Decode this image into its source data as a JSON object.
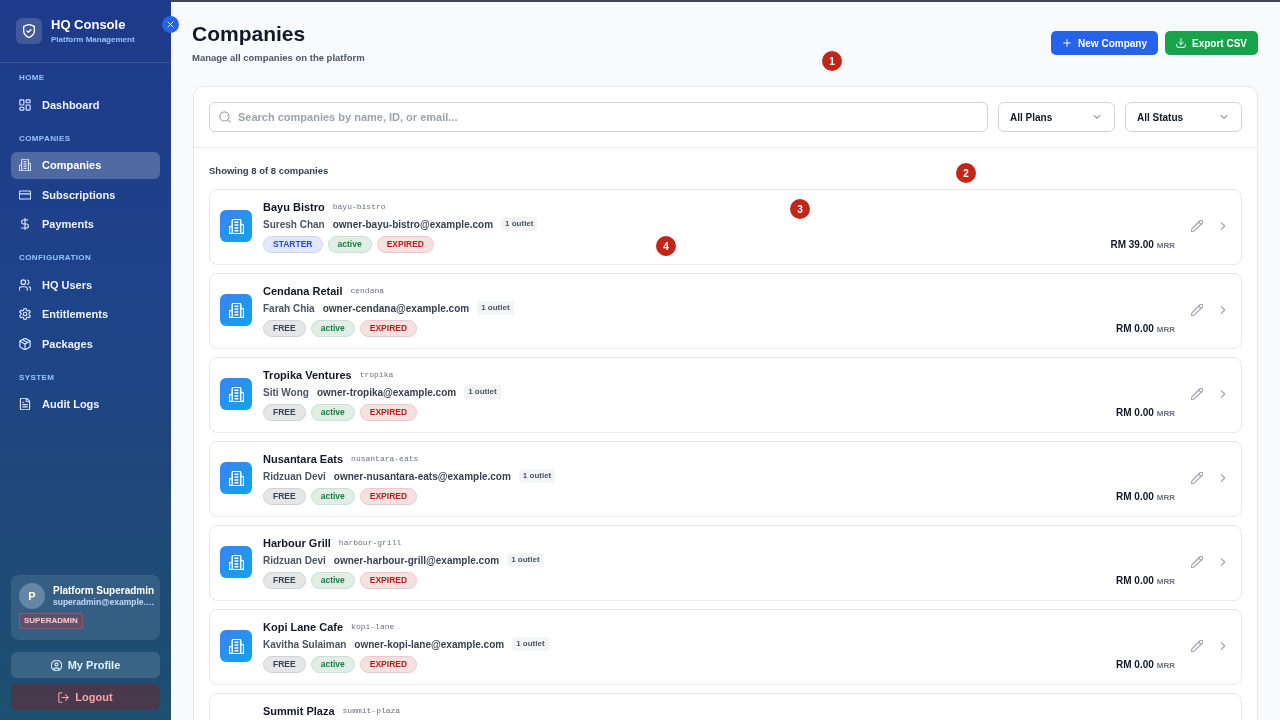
{
  "sidebar": {
    "title": "HQ Console",
    "subtitle": "Platform Management",
    "sections": [
      {
        "label": "HOME",
        "items": [
          {
            "label": "Dashboard",
            "selected": false
          }
        ]
      },
      {
        "label": "COMPANIES",
        "items": [
          {
            "label": "Companies",
            "selected": true
          },
          {
            "label": "Subscriptions",
            "selected": false
          },
          {
            "label": "Payments",
            "selected": false
          }
        ]
      },
      {
        "label": "CONFIGURATION",
        "items": [
          {
            "label": "HQ Users",
            "selected": false
          },
          {
            "label": "Entitlements",
            "selected": false
          },
          {
            "label": "Packages",
            "selected": false
          }
        ]
      },
      {
        "label": "SYSTEM",
        "items": [
          {
            "label": "Audit Logs",
            "selected": false
          }
        ]
      }
    ],
    "user": {
      "initial": "P",
      "name": "Platform Superadmin",
      "email": "superadmin@example.…",
      "role": "SUPERADMIN"
    },
    "actions": [
      {
        "label": "My Profile",
        "kind": "profile"
      },
      {
        "label": "Logout",
        "kind": "logout"
      }
    ]
  },
  "header": {
    "title": "Companies",
    "subtitle": "Manage all companies on the platform",
    "actions": [
      {
        "label": "New Company",
        "kind": "new"
      },
      {
        "label": "Export CSV",
        "kind": "export"
      }
    ]
  },
  "filters": {
    "search": {
      "placeholder": "Search companies by name, ID, or email..."
    },
    "selects": [
      {
        "value": "All Plans"
      },
      {
        "value": "All Status"
      }
    ]
  },
  "summary": "Showing 8 of 8 companies",
  "companies": [
    {
      "name": "Bayu Bistro",
      "slug": "bayu-bistro",
      "owner": "Suresh Chan",
      "email": "owner-bayu-bistro@example.com",
      "outlets": "1 outlet",
      "tags": [
        {
          "label": "STARTER",
          "color": "#1d4ed8"
        },
        {
          "label": "active",
          "color": "#15803d"
        },
        {
          "label": "EXPIRED",
          "color": "#b91c1c"
        }
      ],
      "mrr": "RM 39.00",
      "mrr_unit": "MRR"
    },
    {
      "name": "Cendana Retail",
      "slug": "cendana",
      "owner": "Farah Chia",
      "email": "owner-cendana@example.com",
      "outlets": "1 outlet",
      "tags": [
        {
          "label": "FREE",
          "color": "#374151"
        },
        {
          "label": "active",
          "color": "#15803d"
        },
        {
          "label": "EXPIRED",
          "color": "#b91c1c"
        }
      ],
      "mrr": "RM 0.00",
      "mrr_unit": "MRR"
    },
    {
      "name": "Tropika Ventures",
      "slug": "tropika",
      "owner": "Siti Wong",
      "email": "owner-tropika@example.com",
      "outlets": "1 outlet",
      "tags": [
        {
          "label": "FREE",
          "color": "#374151"
        },
        {
          "label": "active",
          "color": "#15803d"
        },
        {
          "label": "EXPIRED",
          "color": "#b91c1c"
        }
      ],
      "mrr": "RM 0.00",
      "mrr_unit": "MRR"
    },
    {
      "name": "Nusantara Eats",
      "slug": "nusantara-eats",
      "owner": "Ridzuan Devi",
      "email": "owner-nusantara-eats@example.com",
      "outlets": "1 outlet",
      "tags": [
        {
          "label": "FREE",
          "color": "#374151"
        },
        {
          "label": "active",
          "color": "#15803d"
        },
        {
          "label": "EXPIRED",
          "color": "#b91c1c"
        }
      ],
      "mrr": "RM 0.00",
      "mrr_unit": "MRR"
    },
    {
      "name": "Harbour Grill",
      "slug": "harbour-grill",
      "owner": "Ridzuan Devi",
      "email": "owner-harbour-grill@example.com",
      "outlets": "1 outlet",
      "tags": [
        {
          "label": "FREE",
          "color": "#374151"
        },
        {
          "label": "active",
          "color": "#15803d"
        },
        {
          "label": "EXPIRED",
          "color": "#b91c1c"
        }
      ],
      "mrr": "RM 0.00",
      "mrr_unit": "MRR"
    },
    {
      "name": "Kopi Lane Cafe",
      "slug": "kopi-lane",
      "owner": "Kavitha Sulaiman",
      "email": "owner-kopi-lane@example.com",
      "outlets": "1 outlet",
      "tags": [
        {
          "label": "FREE",
          "color": "#374151"
        },
        {
          "label": "active",
          "color": "#15803d"
        },
        {
          "label": "EXPIRED",
          "color": "#b91c1c"
        }
      ],
      "mrr": "RM 0.00",
      "mrr_unit": "MRR"
    },
    {
      "name": "Summit Plaza",
      "slug": "summit-plaza"
    }
  ],
  "annotations": [
    "1",
    "2",
    "3",
    "4"
  ]
}
